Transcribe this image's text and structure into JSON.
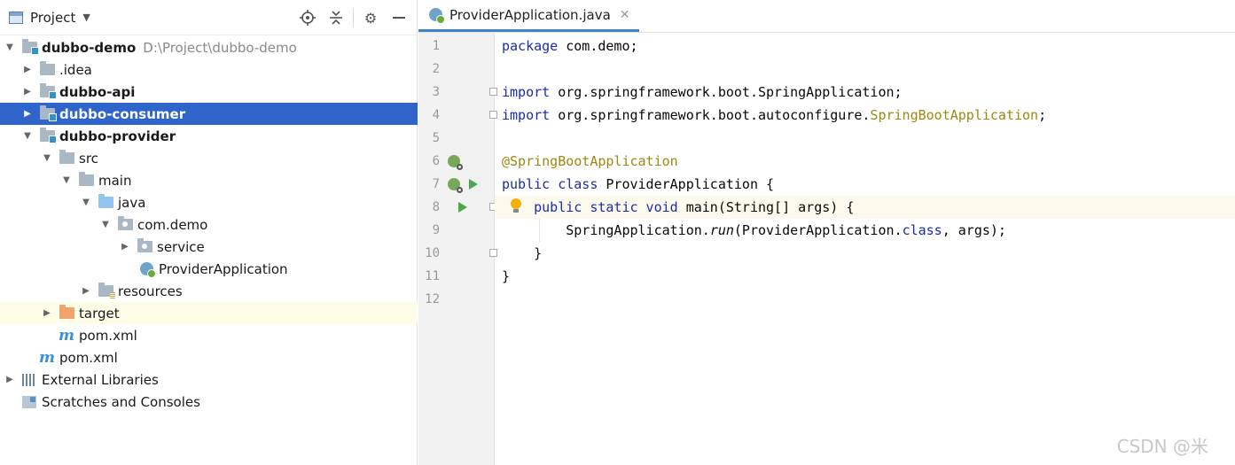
{
  "project_panel": {
    "title": "Project",
    "tools": [
      "locate-icon",
      "collapse-icon",
      "gear-icon",
      "hide-icon"
    ]
  },
  "tree": [
    {
      "label": "dubbo-demo",
      "hint": "D:\\Project\\dubbo-demo",
      "icon": "module-folder",
      "arrow": "down",
      "bold": true
    },
    {
      "label": ".idea",
      "hint": "",
      "icon": "folder",
      "arrow": "right",
      "bold": false
    },
    {
      "label": "dubbo-api",
      "hint": "",
      "icon": "module-folder",
      "arrow": "right",
      "bold": true
    },
    {
      "label": "dubbo-consumer",
      "hint": "",
      "icon": "module-folder",
      "arrow": "right",
      "bold": true,
      "selected": true
    },
    {
      "label": "dubbo-provider",
      "hint": "",
      "icon": "module-folder",
      "arrow": "down",
      "bold": true
    },
    {
      "label": "src",
      "hint": "",
      "icon": "folder",
      "arrow": "down",
      "bold": false
    },
    {
      "label": "main",
      "hint": "",
      "icon": "folder",
      "arrow": "down",
      "bold": false
    },
    {
      "label": "java",
      "hint": "",
      "icon": "source-folder",
      "arrow": "down",
      "bold": false
    },
    {
      "label": "com.demo",
      "hint": "",
      "icon": "package",
      "arrow": "down",
      "bold": false
    },
    {
      "label": "service",
      "hint": "",
      "icon": "package",
      "arrow": "right",
      "bold": false
    },
    {
      "label": "ProviderApplication",
      "hint": "",
      "icon": "spring-class",
      "arrow": "",
      "bold": false
    },
    {
      "label": "resources",
      "hint": "",
      "icon": "resources-folder",
      "arrow": "right",
      "bold": false
    },
    {
      "label": "target",
      "hint": "",
      "icon": "excluded-folder",
      "arrow": "right",
      "bold": false,
      "hover": true
    },
    {
      "label": "pom.xml",
      "hint": "",
      "icon": "maven",
      "arrow": "",
      "bold": false
    },
    {
      "label": "pom.xml",
      "hint": "",
      "icon": "maven",
      "arrow": "",
      "bold": false
    },
    {
      "label": "External Libraries",
      "hint": "",
      "icon": "library",
      "arrow": "right",
      "bold": false
    },
    {
      "label": "Scratches and Consoles",
      "hint": "",
      "icon": "scratch",
      "arrow": "",
      "bold": false
    }
  ],
  "editor": {
    "tab_label": "ProviderApplication.java",
    "line_numbers": [
      "1",
      "2",
      "3",
      "4",
      "5",
      "6",
      "7",
      "8",
      "9",
      "10",
      "11",
      "12"
    ],
    "code": {
      "l1_kw": "package",
      "l1_rest": " com.demo;",
      "l3_kw": "import",
      "l3_rest": " org.springframework.boot.SpringApplication;",
      "l4_kw": "import",
      "l4_mid": " org.springframework.boot.autoconfigure.",
      "l4_ann": "SpringBootApplication",
      "l4_end": ";",
      "l6_ann": "@SpringBootApplication",
      "l7_kw": "public class",
      "l7_rest": " ProviderApplication {",
      "l8_pre": "    ",
      "l8_kw": "public static void",
      "l8_rest": " main(String[] args) {",
      "l9_pre": "        SpringApplication.",
      "l9_it": "run",
      "l9_mid": "(ProviderApplication.",
      "l9_kw": "class",
      "l9_end": ", args);",
      "l10": "    }",
      "l11": "}"
    }
  },
  "watermark": "CSDN @米"
}
